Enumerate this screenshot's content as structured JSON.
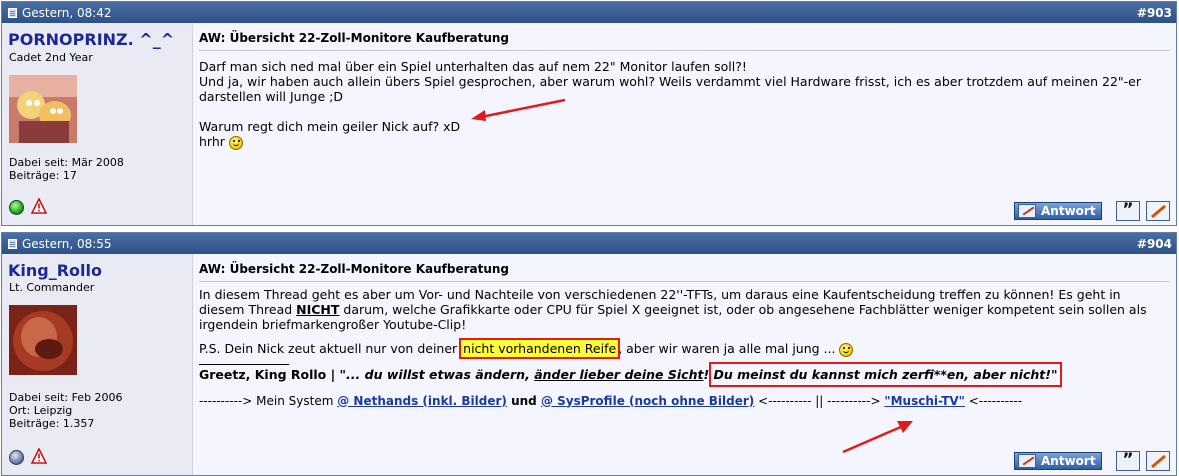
{
  "posts": [
    {
      "date": "Gestern, 08:42",
      "number": "#903",
      "user": {
        "name": "PORNOPRINZ. ^_^",
        "rank": "Cadet 2nd Year",
        "joined": "Dabei seit: Mär 2008",
        "posts": "Beiträge: 17",
        "status": "online"
      },
      "title": "AW: Übersicht 22-Zoll-Monitore Kaufberatung",
      "body": {
        "line1": "Darf man sich ned mal über ein Spiel unterhalten das auf nem 22\" Monitor laufen soll?!",
        "line2": "Und ja, wir haben auch allein übers Spiel gesprochen, aber warum wohl? Weils verdammt viel Hardware frisst, ich es aber trotzdem auf meinen 22\"-er",
        "line3": "darstellen will Junge ;D",
        "line4": "Warum regt dich mein geiler Nick auf? xD",
        "line5": "hrhr"
      },
      "buttons": {
        "answer": "Antwort"
      }
    },
    {
      "date": "Gestern, 08:55",
      "number": "#904",
      "user": {
        "name": "King_Rollo",
        "rank": "Lt. Commander",
        "joined": "Dabei seit: Feb 2006",
        "location": "Ort: Leipzig",
        "posts": "Beiträge: 1.357",
        "status": "offline"
      },
      "title": "AW: Übersicht 22-Zoll-Monitore Kaufberatung",
      "body": {
        "para1_a": "In diesem Thread geht es aber um Vor- und Nachteile von verschiedenen 22''-TFTs, um daraus eine Kaufentscheidung treffen zu können! Es geht in diesem Thread ",
        "para1_bold": "NICHT",
        "para1_b": " darum, welche Grafikkarte oder CPU für Spiel X geeignet ist, oder ob angesehene Fachblätter weniger kompetent sein sollen als irgendein briefmarkengroßer Youtube-Clip!",
        "para2_a": "P.S. Dein Nick zeut aktuell nur von deiner ",
        "para2_highlight": "nicht vorhandenen Reife",
        "para2_b": ", aber wir waren ja alle mal jung ...",
        "sig_a": "Greetz, King Rollo | ",
        "sig_b": "\"... du willst etwas ändern, ",
        "sig_underline": "änder lieber deine Sicht",
        "sig_c": "! ",
        "sig_boxed": "Du meinst du kannst mich zerfi**en, aber nicht!\"",
        "sys_a": "----------> Mein System ",
        "sys_link1": "@ Nethands (inkl. Bilder)",
        "sys_und": " und ",
        "sys_link2": "@ SysProfile (noch ohne Bilder)",
        "sys_b": " <---------- || ----------> ",
        "sys_link3": "\"Muschi-TV\"",
        "sys_c": " <----------"
      },
      "buttons": {
        "answer": "Antwort"
      }
    }
  ],
  "colors": {
    "header": "#2e5087",
    "username": "#1b2896",
    "highlight": "#ffff33",
    "annotation": "#e01b1b",
    "link": "#1b3aa0"
  }
}
